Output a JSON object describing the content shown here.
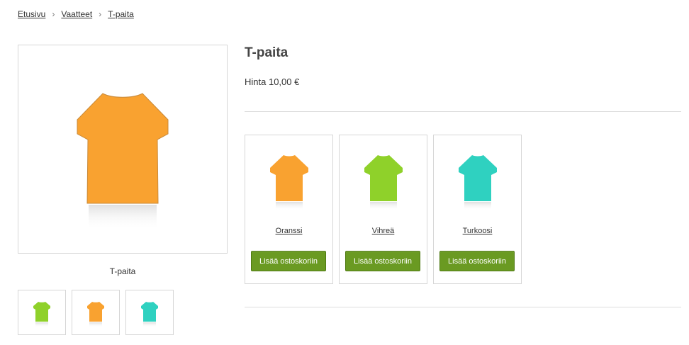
{
  "breadcrumb": {
    "items": [
      "Etusivu",
      "Vaatteet",
      "T-paita"
    ],
    "separator": "›"
  },
  "product": {
    "title": "T-paita",
    "price": "Hinta 10,00 €",
    "image_caption": "T-paita",
    "main_image_color": "#f9a230",
    "main_image_icon": "t-shirt-icon"
  },
  "thumbnails": [
    {
      "color": "#8fd12a",
      "icon": "t-shirt-icon"
    },
    {
      "color": "#f9a230",
      "icon": "t-shirt-icon"
    },
    {
      "color": "#2fd1c0",
      "icon": "t-shirt-icon"
    }
  ],
  "variants": [
    {
      "name": "Oranssi",
      "color": "#f9a230",
      "button": "Lisää ostoskoriin"
    },
    {
      "name": "Vihreä",
      "color": "#8fd12a",
      "button": "Lisää ostoskoriin"
    },
    {
      "name": "Turkoosi",
      "color": "#2fd1c0",
      "button": "Lisää ostoskoriin"
    }
  ],
  "colors": {
    "button": "#6a9a22",
    "border": "#d6d6d6",
    "divider": "#dcdcdc"
  }
}
